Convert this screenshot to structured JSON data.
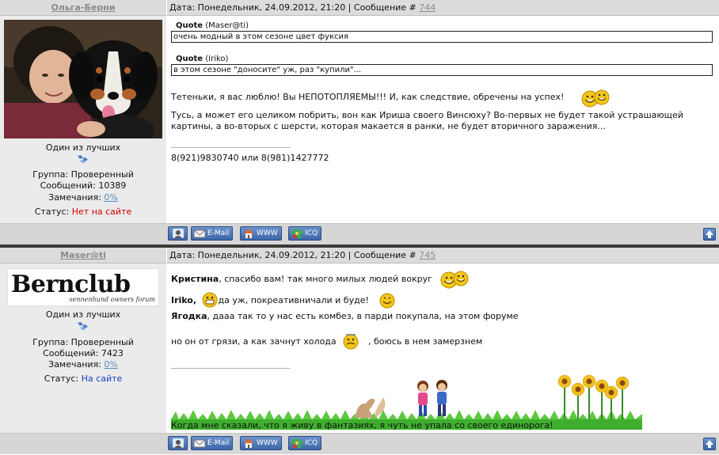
{
  "posts": [
    {
      "author": "Ольга-Берни",
      "header": {
        "prefix": "Дата: Понедельник, 24.09.2012, 21:20 | Сообщение # ",
        "number": "744"
      },
      "user": {
        "rank": "Один из лучших",
        "group": "Группа: Проверенный",
        "messages": "Сообщений: 10389",
        "warnings_label": "Замечания: ",
        "warnings_value": "0%",
        "status_label": "Статус: ",
        "status_value": "Нет на сайте"
      },
      "quotes": [
        {
          "label": "Quote",
          "author": "(Maser@ti)",
          "text": "очень модный в этом сезоне цвет фуксия"
        },
        {
          "label": "Quote",
          "author": "(Iriko)",
          "text": "в этом сезоне \"доносите\" уж, раз \"купили\"..."
        }
      ],
      "lines": [
        "Тетеньки, я вас люблю! Вы НЕПОТОПЛЯЕМЫ!!! И, как следствие, обречены на успех!",
        "Тусь, а может его целиком побрить, вон как Ириша своего Винсюху? Во-первых не будет такой устрашающей",
        "картины, а во-вторых с шерсти, которая макается в ранки, не будет вторичного заражения..."
      ],
      "signature": "8(921)9830740 или 8(981)1427772"
    },
    {
      "author": "Maser@ti",
      "header": {
        "prefix": "Дата: Понедельник, 24.09.2012, 21:20 | Сообщение # ",
        "number": "745"
      },
      "logo": {
        "title": "Bernclub",
        "subtitle": "sennenhund owners forum"
      },
      "user": {
        "rank": "Один из лучших",
        "group": "Группа: Проверенный",
        "messages": "Сообщений: 7423",
        "warnings_label": "Замечания: ",
        "warnings_value": "0%",
        "status_label": "Статус: ",
        "status_value": "На сайте"
      },
      "lines": [
        {
          "name": "Кристина",
          "text": ", спасибо вам! так много милых людей вокруг"
        },
        {
          "name": "Iriko,",
          "text": " да уж, покреативничали и буде!"
        },
        {
          "name": "Ягодка",
          "text": ", дааа так то у нас есть комбез, в парди покупала, на этом форуме"
        },
        {
          "name": "",
          "text": "но он от грязи, а как зачнут холода"
        },
        {
          "name": "",
          "text": ", боюсь в нем замерзнем"
        }
      ],
      "signature": "Когда мне сказали, что я живу в фантазиях, я чуть не упала со своего единорога!"
    }
  ],
  "footer_buttons": {
    "email": "E-Mail",
    "www": "WWW",
    "icq": "ICQ"
  },
  "icons": {
    "profile": "profile-icon",
    "email": "envelope-icon",
    "www": "house-icon",
    "icq": "icq-flower-icon",
    "top": "arrow-up-icon",
    "rank": "rank-stars-icon"
  },
  "colors": {
    "header_bg": "#dcdcdc",
    "panel_bg": "#ebebeb",
    "footer_bg": "#d6d6d6",
    "button_blue": "#4a73b5",
    "status_offline": "#cc0000",
    "status_online": "#1e40c0",
    "link_gray": "#8a8a8a"
  }
}
